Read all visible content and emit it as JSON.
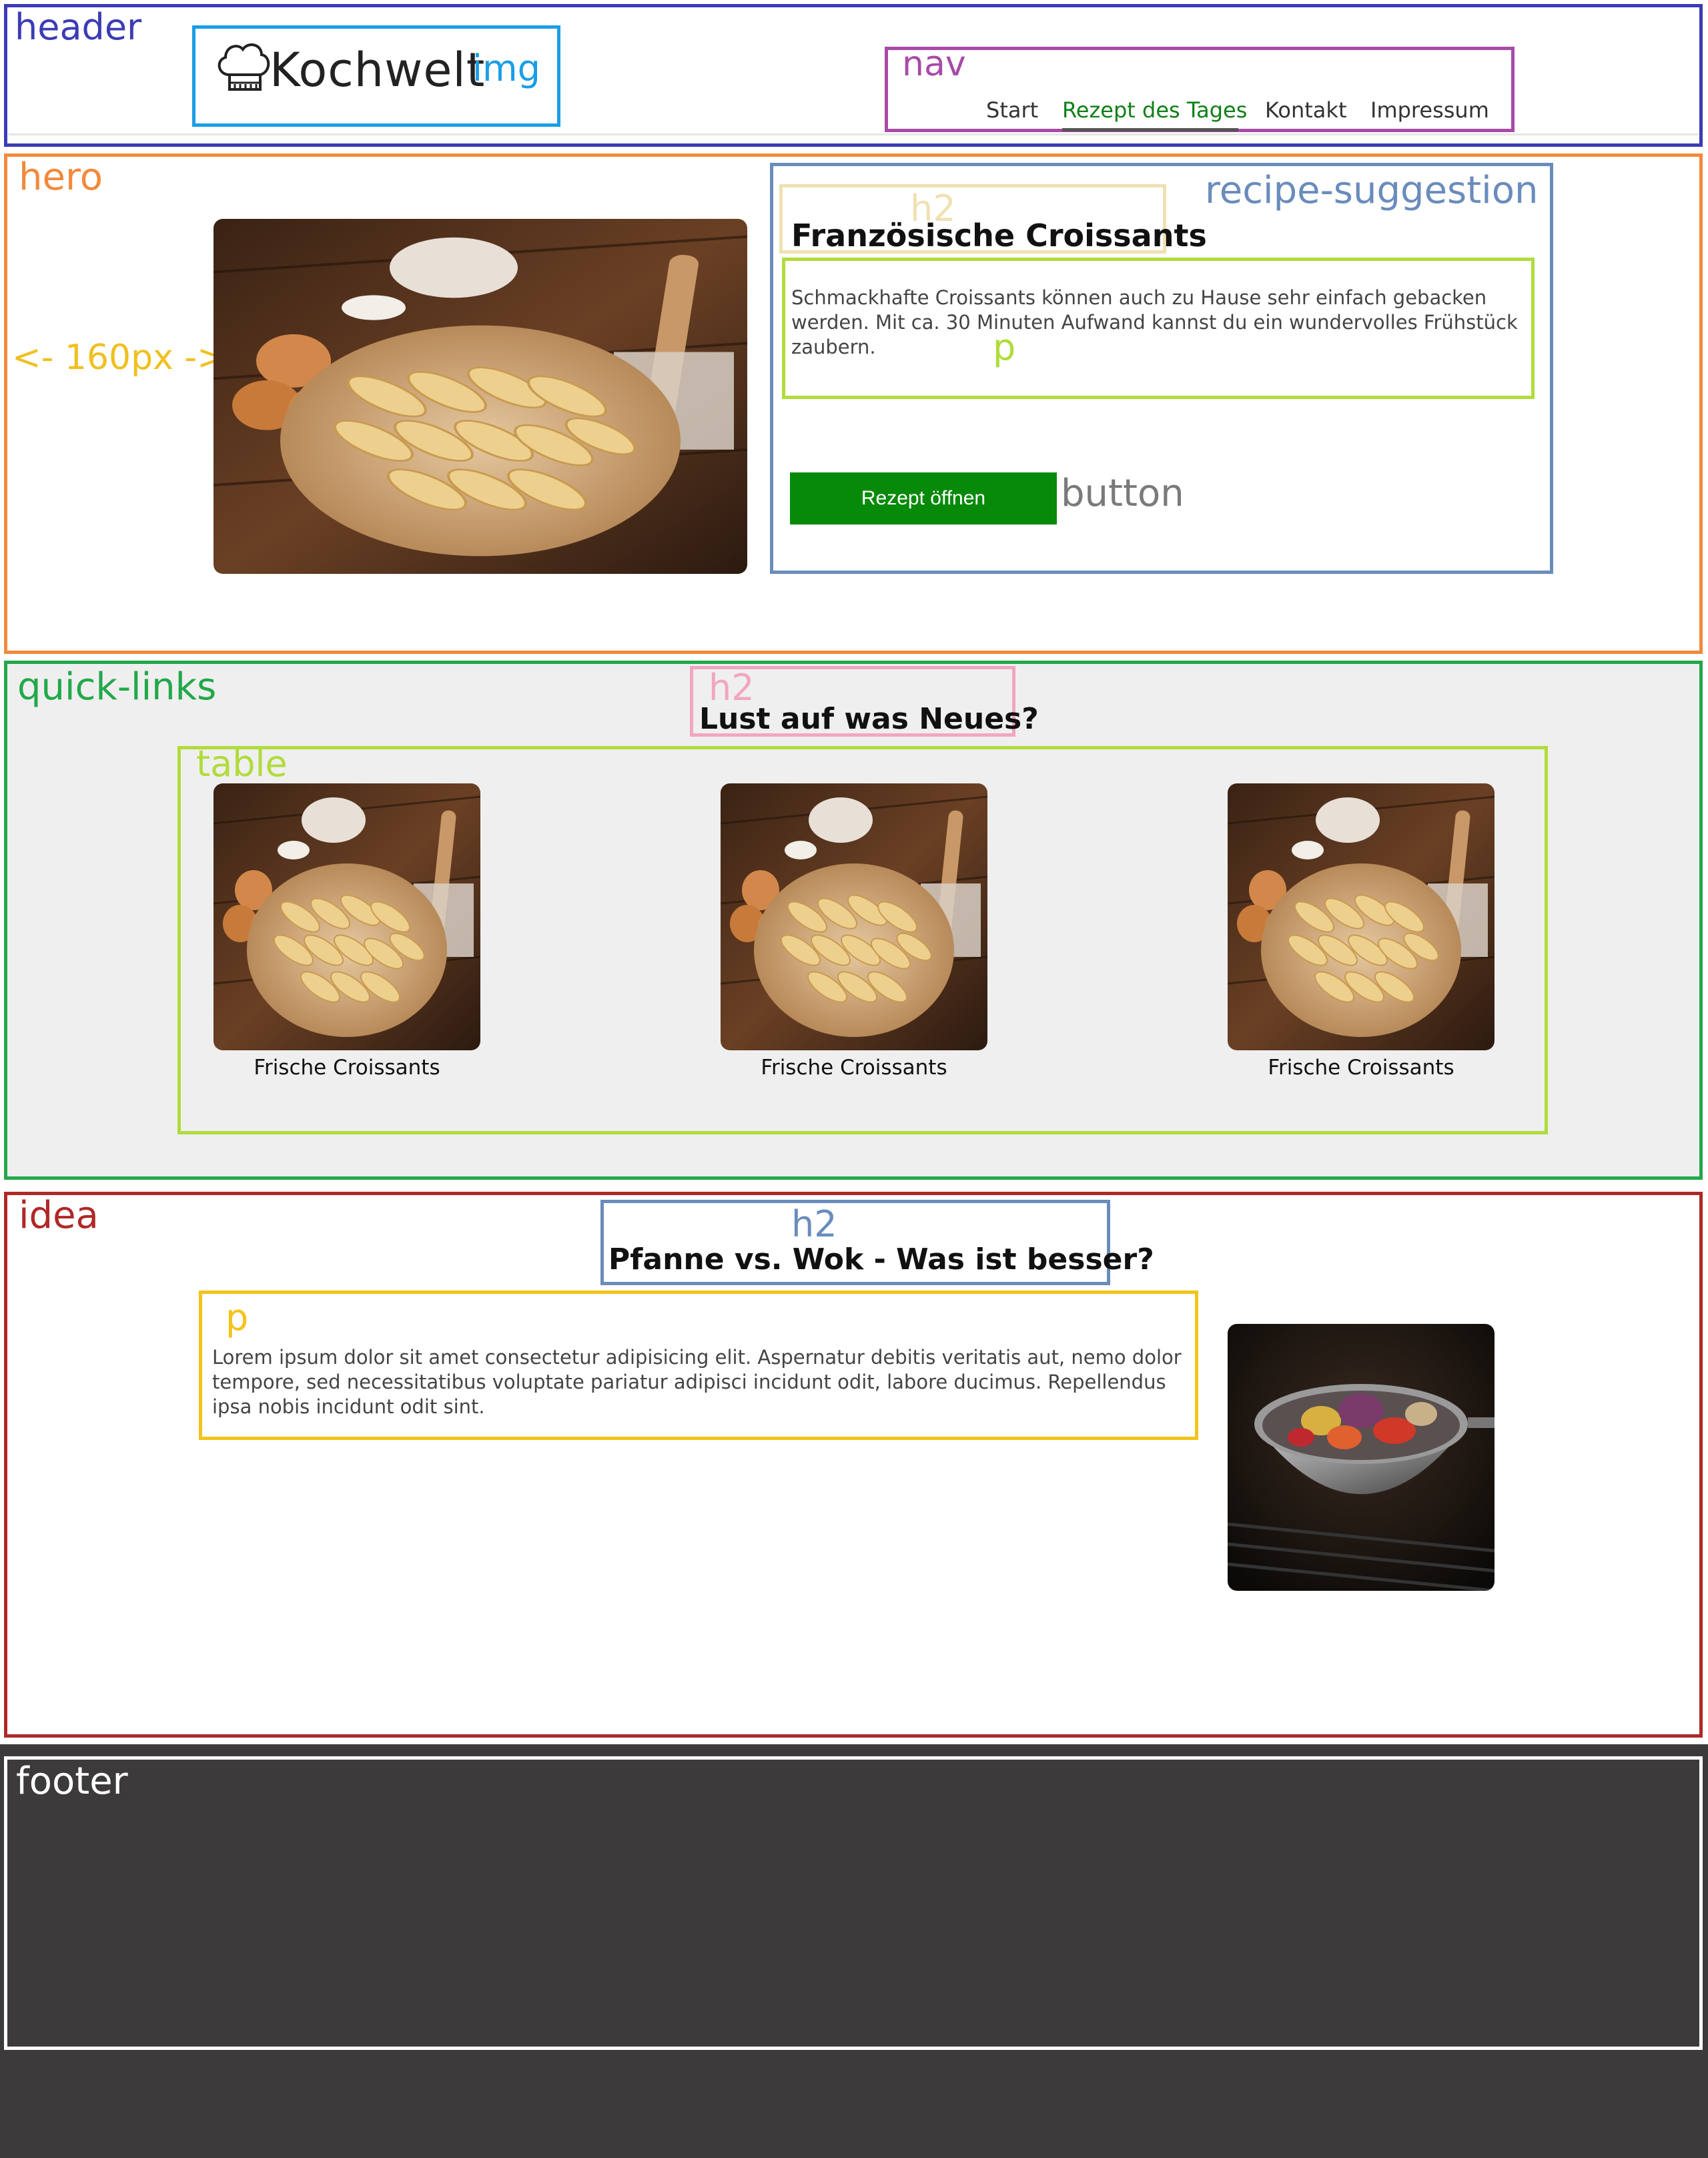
{
  "annotations": {
    "header": "header",
    "logo_img": "img",
    "nav": "nav",
    "hero": "hero",
    "hero_margin": "<- 160px ->",
    "recipe_suggestion": "recipe-suggestion",
    "recipe_h2": "h2",
    "recipe_p": "p",
    "recipe_button": "button",
    "quick_links": "quick-links",
    "quick_links_h2": "h2",
    "table": "table",
    "idea": "idea",
    "idea_h2": "h2",
    "idea_p": "p",
    "footer": "footer"
  },
  "colors": {
    "header": "#3c3cb6",
    "logo_img": "#1a9ee6",
    "nav": "#a84aa8",
    "hero": "#f28a3c",
    "margin_note": "#f0c020",
    "recipe_suggestion": "#6a8cbc",
    "recipe_h2": "#f0e1b2",
    "paragraph": "#b0dc3c",
    "button": "#078a0a",
    "quick_links": "#22a84a",
    "quick_links_h2": "#f2a6c0",
    "idea": "#b02828",
    "idea_p": "#f2c418",
    "footer_bg": "#3c3a3a",
    "nav_active": "#0f7f17"
  },
  "header": {
    "logo_text": "Kochwelt",
    "logo_icon": "chef-hat-icon"
  },
  "nav": {
    "items": [
      "Start",
      "Rezept des Tages",
      "Kontakt",
      "Impressum"
    ],
    "active_index": 1
  },
  "hero": {
    "image": "croissant-dough-photo",
    "recipe": {
      "title": "Französische Croissants",
      "text": "Schmackhafte Croissants können auch zu Hause sehr einfach gebacken werden. Mit ca. 30 Minuten Aufwand kannst du ein wundervolles Frühstück zaubern.",
      "button_label": "Rezept öffnen"
    }
  },
  "quick_links": {
    "title": "Lust auf was Neues?",
    "items": [
      {
        "caption": "Frische Croissants",
        "image": "croissant-dough-photo"
      },
      {
        "caption": "Frische Croissants",
        "image": "croissant-dough-photo"
      },
      {
        "caption": "Frische Croissants",
        "image": "croissant-dough-photo"
      }
    ]
  },
  "idea": {
    "title": "Pfanne vs. Wok - Was ist besser?",
    "text": "Lorem ipsum dolor sit amet consectetur adipisicing elit. Aspernatur debitis veritatis aut, nemo dolor tempore, sed necessitatibus voluptate pariatur adipisci incidunt odit, labore ducimus. Repellendus ipsa nobis incidunt odit sint.",
    "image": "wok-vegetables-photo"
  }
}
